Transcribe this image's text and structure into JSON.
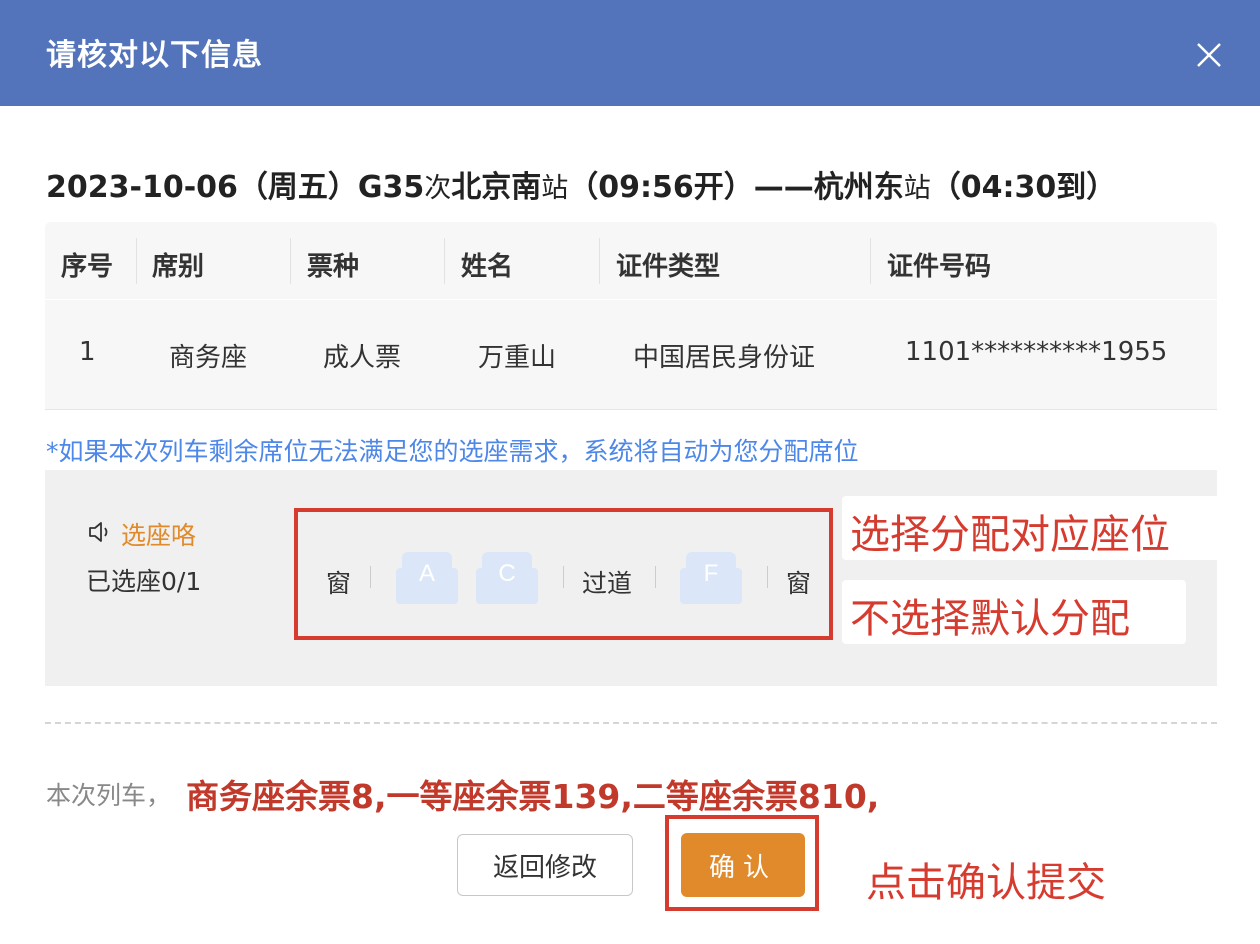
{
  "dialog": {
    "title": "请核对以下信息",
    "close_icon": "close-icon"
  },
  "trip": {
    "date": "2023-10-06（周五）",
    "train_no": "G35",
    "ci": "次",
    "from_station": "北京南",
    "zhan1": "站",
    "depart": "（09:56开）——",
    "to_station": "杭州东",
    "zhan2": "站",
    "arrive": "（04:30到）"
  },
  "passenger_table": {
    "headers": [
      "序号",
      "席别",
      "票种",
      "姓名",
      "证件类型",
      "证件号码"
    ],
    "rows": [
      [
        "1",
        "商务座",
        "成人票",
        "万重山",
        "中国居民身份证",
        "1101**********1955"
      ]
    ]
  },
  "notice": "*如果本次列车剩余席位无法满足您的选座需求，系统将自动为您分配席位",
  "seat_select": {
    "tip_label": "选座咯",
    "speaker_icon": "speaker-icon",
    "count_label": "已选座0/1",
    "window_left": "窗",
    "aisle": "过道",
    "window_right": "窗",
    "seats": [
      "A",
      "C",
      "F"
    ]
  },
  "annotations": {
    "select_seat": "选择分配对应座位",
    "no_select": "不选择默认分配",
    "click_confirm": "点击确认提交"
  },
  "remaining": {
    "prefix": "本次列车，",
    "text": "商务座余票8,一等座余票139,二等座余票810,"
  },
  "buttons": {
    "back": "返回修改",
    "confirm": "确认"
  },
  "colors": {
    "header": "#5373bb",
    "accent_orange": "#e08a2b",
    "annotation_red": "#d63b2f",
    "notice_blue": "#4d87e8"
  }
}
